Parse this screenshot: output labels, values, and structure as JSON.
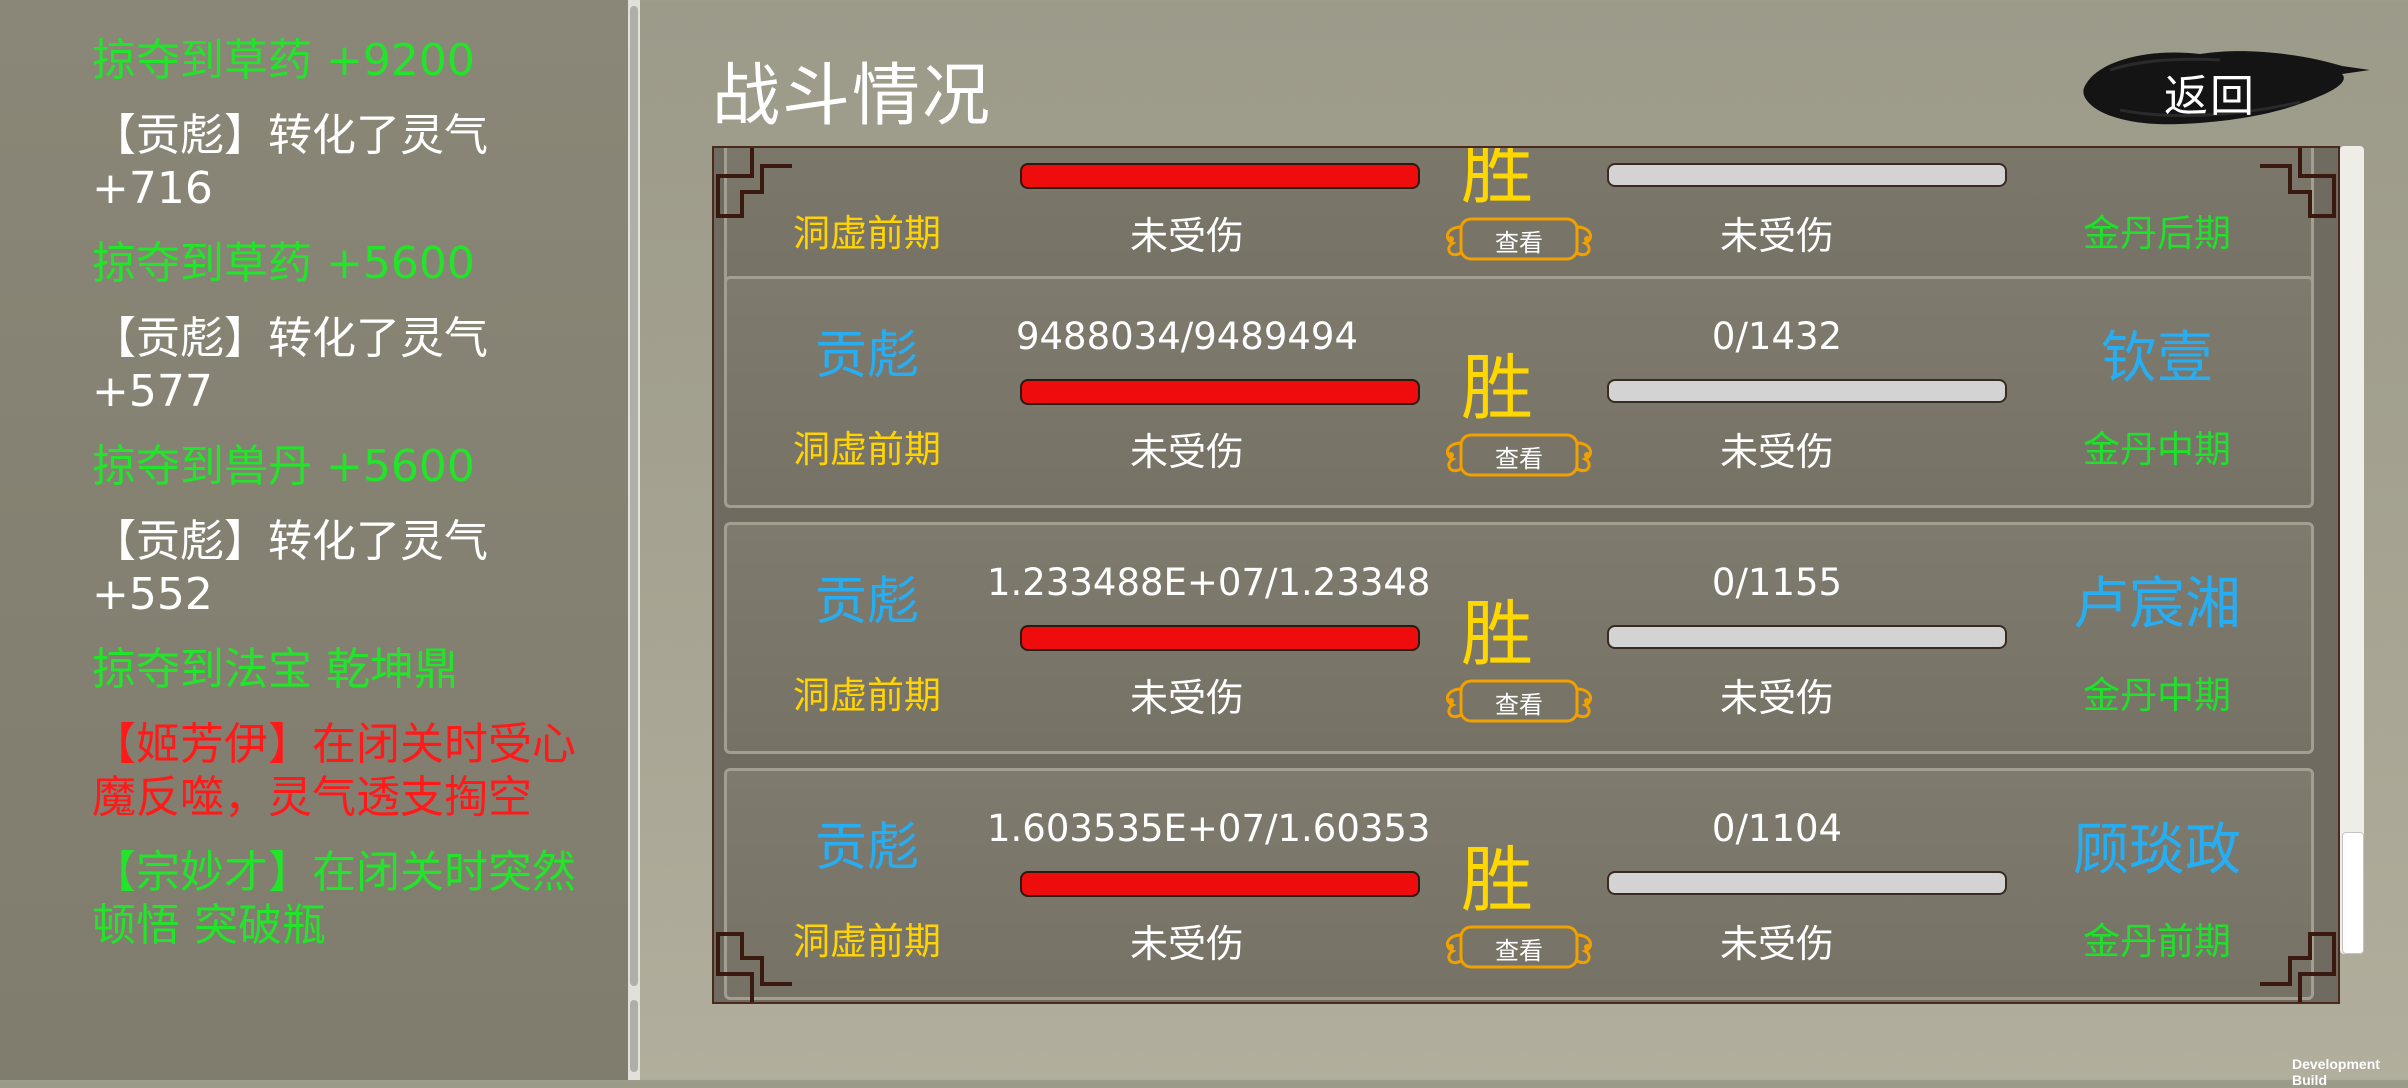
{
  "log": {
    "entries": [
      {
        "text": "掠夺到草药 +9200",
        "color": "green"
      },
      {
        "text": "【贡彪】转化了灵气 +716",
        "color": "white"
      },
      {
        "text": "掠夺到草药 +5600",
        "color": "green"
      },
      {
        "text": "【贡彪】转化了灵气 +577",
        "color": "white"
      },
      {
        "text": "掠夺到兽丹 +5600",
        "color": "green"
      },
      {
        "text": "【贡彪】转化了灵气 +552",
        "color": "white"
      },
      {
        "text": "掠夺到法宝 乾坤鼎",
        "color": "green"
      },
      {
        "text": "【姬芳伊】在闭关时受心魔反噬，灵气透支掏空",
        "color": "red"
      },
      {
        "text": "【宗妙才】在闭关时突然顿悟 突破瓶",
        "color": "green"
      }
    ]
  },
  "header": {
    "title": "战斗情况",
    "back_label": "返回"
  },
  "battles": [
    {
      "player_name": "",
      "player_realm": "洞虚前期",
      "player_hp": "",
      "player_hp_fraction": 1.0,
      "player_status": "未受伤",
      "result": "胜",
      "view_label": "查看",
      "opponent_hp": "",
      "opponent_hp_fraction": 0.0,
      "opponent_status": "未受伤",
      "opponent_name": "",
      "opponent_realm": "金丹后期"
    },
    {
      "player_name": "贡彪",
      "player_realm": "洞虚前期",
      "player_hp": "9488034/9489494",
      "player_hp_fraction": 0.9998,
      "player_status": "未受伤",
      "result": "胜",
      "view_label": "查看",
      "opponent_hp": "0/1432",
      "opponent_hp_fraction": 0.0,
      "opponent_status": "未受伤",
      "opponent_name": "钦壹",
      "opponent_realm": "金丹中期"
    },
    {
      "player_name": "贡彪",
      "player_realm": "洞虚前期",
      "player_hp": "1.233488E+07/1.23348",
      "player_hp_fraction": 1.0,
      "player_status": "未受伤",
      "result": "胜",
      "view_label": "查看",
      "opponent_hp": "0/1155",
      "opponent_hp_fraction": 0.0,
      "opponent_status": "未受伤",
      "opponent_name": "卢宸湘",
      "opponent_realm": "金丹中期"
    },
    {
      "player_name": "贡彪",
      "player_realm": "洞虚前期",
      "player_hp": "1.603535E+07/1.60353",
      "player_hp_fraction": 1.0,
      "player_status": "未受伤",
      "result": "胜",
      "view_label": "查看",
      "opponent_hp": "0/1104",
      "opponent_hp_fraction": 0.0,
      "opponent_status": "未受伤",
      "opponent_name": "顾琰政",
      "opponent_realm": "金丹前期"
    }
  ],
  "footer": {
    "dev_build": "Development Build"
  },
  "colors": {
    "log_green": "#22e42a",
    "log_red": "#ff1a1a",
    "player_name": "#27aef2",
    "player_realm": "#ffd400",
    "opponent_realm": "#1fe02a",
    "result": "#ffd700",
    "hp_bar": "#ee0c0c"
  },
  "icons": [
    "ink-brush-icon",
    "ornate-frame-corner-icon",
    "ornate-button-frame-icon"
  ]
}
